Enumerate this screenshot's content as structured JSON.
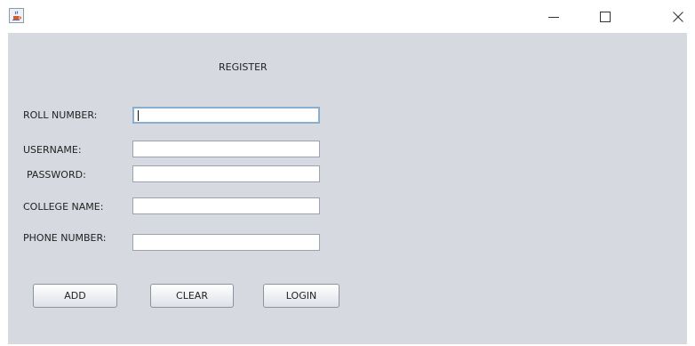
{
  "form": {
    "title": "REGISTER",
    "fields": {
      "roll_number": {
        "label": "ROLL NUMBER:",
        "value": ""
      },
      "username": {
        "label": "USERNAME:",
        "value": ""
      },
      "password": {
        "label": "PASSWORD:",
        "value": ""
      },
      "college_name": {
        "label": "COLLEGE NAME:",
        "value": ""
      },
      "phone_number": {
        "label": "PHONE NUMBER:",
        "value": ""
      }
    }
  },
  "buttons": {
    "add": "ADD",
    "clear": "CLEAR",
    "login": "LOGIN"
  },
  "window_controls": {
    "minimize_icon": "minimize-icon",
    "maximize_icon": "maximize-icon",
    "close_icon": "close-icon",
    "app_icon": "java-cup-icon"
  },
  "colors": {
    "client_background": "#d6d9e0",
    "focus_border": "#8aaed0"
  }
}
